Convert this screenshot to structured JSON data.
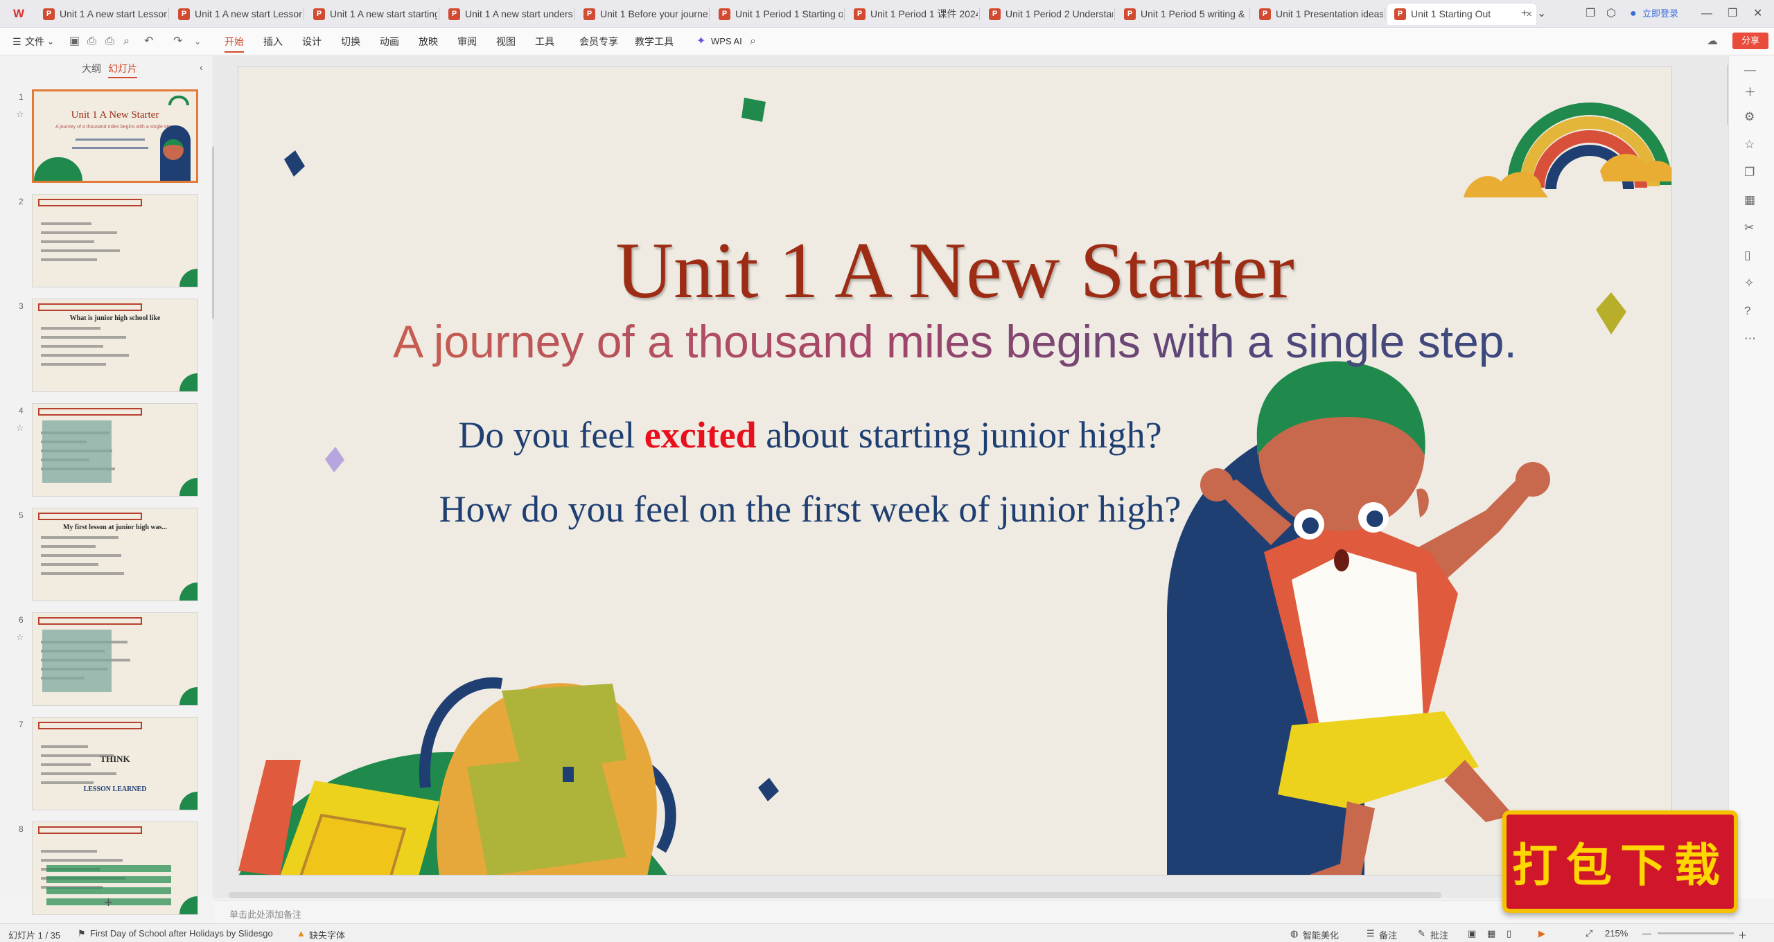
{
  "app": {
    "logo": "W"
  },
  "tabs": [
    {
      "label": "Unit 1 A new start Lesson",
      "active": false
    },
    {
      "label": "Unit 1 A new start Lesson",
      "active": false
    },
    {
      "label": "Unit 1 A new start starting",
      "active": false
    },
    {
      "label": "Unit 1 A new start unders",
      "active": false
    },
    {
      "label": "Unit 1 Before your journe",
      "active": false
    },
    {
      "label": "Unit 1 Period 1 Starting o",
      "active": false
    },
    {
      "label": "Unit 1 Period 1 课件 2024",
      "active": false
    },
    {
      "label": "Unit 1 Period 2 Understan",
      "active": false
    },
    {
      "label": "Unit 1 Period 5 writing &",
      "active": false
    },
    {
      "label": "Unit 1 Presentation ideas",
      "active": false
    },
    {
      "label": "Unit 1 Starting Out",
      "active": true
    }
  ],
  "titlebar": {
    "login_label": "立即登录",
    "new_tab": "+"
  },
  "ribbon": {
    "file_menu": "文件",
    "tabs": [
      "开始",
      "插入",
      "设计",
      "切换",
      "动画",
      "放映",
      "审阅",
      "视图",
      "工具",
      "会员专享",
      "教学工具"
    ],
    "active_tab": "开始",
    "wps_ai": "WPS AI",
    "share": "分享"
  },
  "panel": {
    "tabs": [
      "大纲",
      "幻灯片"
    ],
    "active": "幻灯片",
    "add": "+"
  },
  "thumbnails": [
    {
      "num": "1",
      "title": "Unit 1 A New Starter",
      "subtitle": "A journey of a thousand miles begins with a single step."
    },
    {
      "num": "2",
      "title": "",
      "subtitle": ""
    },
    {
      "num": "3",
      "title": "What is junior high school like",
      "subtitle": ""
    },
    {
      "num": "4",
      "title": "",
      "subtitle": ""
    },
    {
      "num": "5",
      "title": "My first lesson at junior high was...",
      "subtitle": ""
    },
    {
      "num": "6",
      "title": "",
      "subtitle": ""
    },
    {
      "num": "7",
      "title": "THINK",
      "subtitle": "LESSON LEARNED"
    },
    {
      "num": "8",
      "title": "",
      "subtitle": ""
    }
  ],
  "slide": {
    "title": "Unit 1 A New Starter",
    "subtitle": "A journey of a thousand miles begins with a single step.",
    "question1_pre": "Do you feel ",
    "question1_emph": "excited",
    "question1_post": " about starting junior high?",
    "question2": "How do you feel on the first week of junior high?"
  },
  "notes": {
    "placeholder": "单击此处添加备注"
  },
  "status": {
    "slide_index": "幻灯片 1 / 35",
    "theme": "First Day of School after Holidays by Slidesgo",
    "missing_font": "缺失字体",
    "beautify": "智能美化",
    "notes": "备注",
    "comments": "批注",
    "zoom": "215%"
  },
  "badge": {
    "text": "打包下载"
  },
  "colors": {
    "accent": "#d04a2b",
    "title": "#9c2c14",
    "question": "#1f3f72",
    "emph": "#e8101c",
    "slide_bg": "#efebe3"
  }
}
